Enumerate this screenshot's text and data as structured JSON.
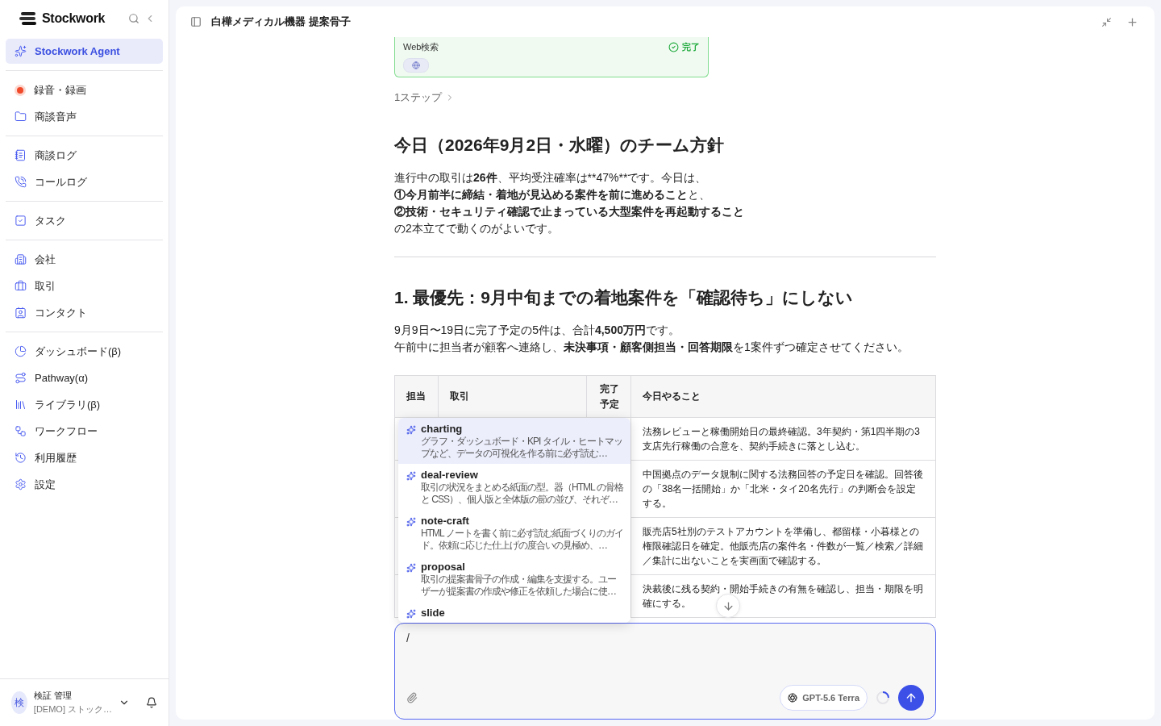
{
  "sidebar": {
    "brand": "Stockwork",
    "groups": [
      [
        {
          "label": "Stockwork Agent",
          "selected": true
        }
      ],
      [
        {
          "label": "録音・録画",
          "selected": false
        },
        {
          "label": "商談音声",
          "selected": false
        }
      ],
      [
        {
          "label": "商談ログ",
          "selected": false
        },
        {
          "label": "コールログ",
          "selected": false
        }
      ],
      [
        {
          "label": "タスク",
          "selected": false
        }
      ],
      [
        {
          "label": "会社",
          "selected": false
        },
        {
          "label": "取引",
          "selected": false
        },
        {
          "label": "コンタクト",
          "selected": false
        }
      ],
      [
        {
          "label": "ダッシュボード(β)",
          "selected": false
        },
        {
          "label": "Pathway(α)",
          "selected": false
        },
        {
          "label": "ライブラリ(β)",
          "selected": false
        },
        {
          "label": "ワークフロー",
          "selected": false
        },
        {
          "label": "利用履歴",
          "selected": false
        },
        {
          "label": "設定",
          "selected": false
        }
      ]
    ],
    "user": {
      "avatar": "検",
      "name": "検証 管理",
      "org": "[DEMO] ストック…"
    }
  },
  "header": {
    "title": "白樺メディカル機器 提案骨子"
  },
  "tool_card": {
    "label": "Web検索",
    "status": "完了"
  },
  "steps": "1ステップ",
  "sections": [
    {
      "heading": "今日（2026年9月2日・水曜）のチーム方針",
      "lines": [
        [
          {
            "text": "進行中の取引は",
            "bold": false
          },
          {
            "text": "26件",
            "bold": true
          },
          {
            "text": "、平均受注確率は**47%**です。今日は、",
            "bold": false
          }
        ],
        [
          {
            "text": "①今月前半に締結・着地が見込める案件を前に進めること",
            "bold": true
          },
          {
            "text": "と、",
            "bold": false
          }
        ],
        [
          {
            "text": "②技術・セキュリティ確認で止まっている大型案件を再起動すること",
            "bold": true
          }
        ],
        [
          {
            "text": "の2本立てで動くのがよいです。",
            "bold": false
          }
        ]
      ]
    },
    {
      "heading": "1. 最優先：9月中旬までの着地案件を「確認待ち」にしない",
      "lines": [
        [
          {
            "text": "9月9日〜19日に完了予定の5件は、合計",
            "bold": false
          },
          {
            "text": "4,500万円",
            "bold": true
          },
          {
            "text": "です。",
            "bold": false
          }
        ],
        [
          {
            "text": "午前中に担当者が顧客へ連絡し、",
            "bold": false
          },
          {
            "text": "未決事項・顧客側担当・回答期限",
            "bold": true
          },
          {
            "text": "を1案件ずつ確定させてください。",
            "bold": false
          }
        ]
      ]
    }
  ],
  "table": {
    "columns": [
      "担当",
      "取引",
      "完了予定",
      "今日やること"
    ],
    "rows": [
      {
        "todo": "法務レビューと稼働開始日の最終確認。3年契約・第1四半期の3支店先行稼働の合意を、契約手続きに落とし込む。"
      },
      {
        "todo": "中国拠点のデータ規制に関する法務回答の予定日を確認。回答後の「38名一括開始」か「北米・タイ20名先行」の判断会を設定する。"
      },
      {
        "todo": "販売店5社別のテストアカウントを準備し、都留様・小暮様との権限確認日を確定。他販売店の案件名・件数が一覧／検索／詳細／集計に出ないことを実画面で確認する。"
      },
      {
        "todo": "決裁後に残る契約・開始手続きの有無を確認し、担当・期限を明確にする。"
      }
    ]
  },
  "skill_menu": [
    {
      "name": "charting",
      "description": "グラフ・ダッシュボード・KPI タイル・ヒートマップなど、データの可視化を作る前に必ず読む…",
      "selected": true
    },
    {
      "name": "deal-review",
      "description": "取引の状況をまとめる紙面の型。器（HTML の骨格と CSS）、個人版と全体版の節の並び、それぞ…",
      "selected": false
    },
    {
      "name": "note-craft",
      "description": "HTML ノートを書く前に必ず読む紙面づくりのガイド。依頼に応じた仕上げの度合いの見極め、…",
      "selected": false
    },
    {
      "name": "proposal",
      "description": "取引の提案書骨子の作成・編集を支援する。ユーザーが提案書の作成や修正を依頼した場合に使…",
      "selected": false
    },
    {
      "name": "slide",
      "selected": false
    }
  ],
  "composer": {
    "value": "/",
    "model": "GPT-5.6 Terra"
  }
}
